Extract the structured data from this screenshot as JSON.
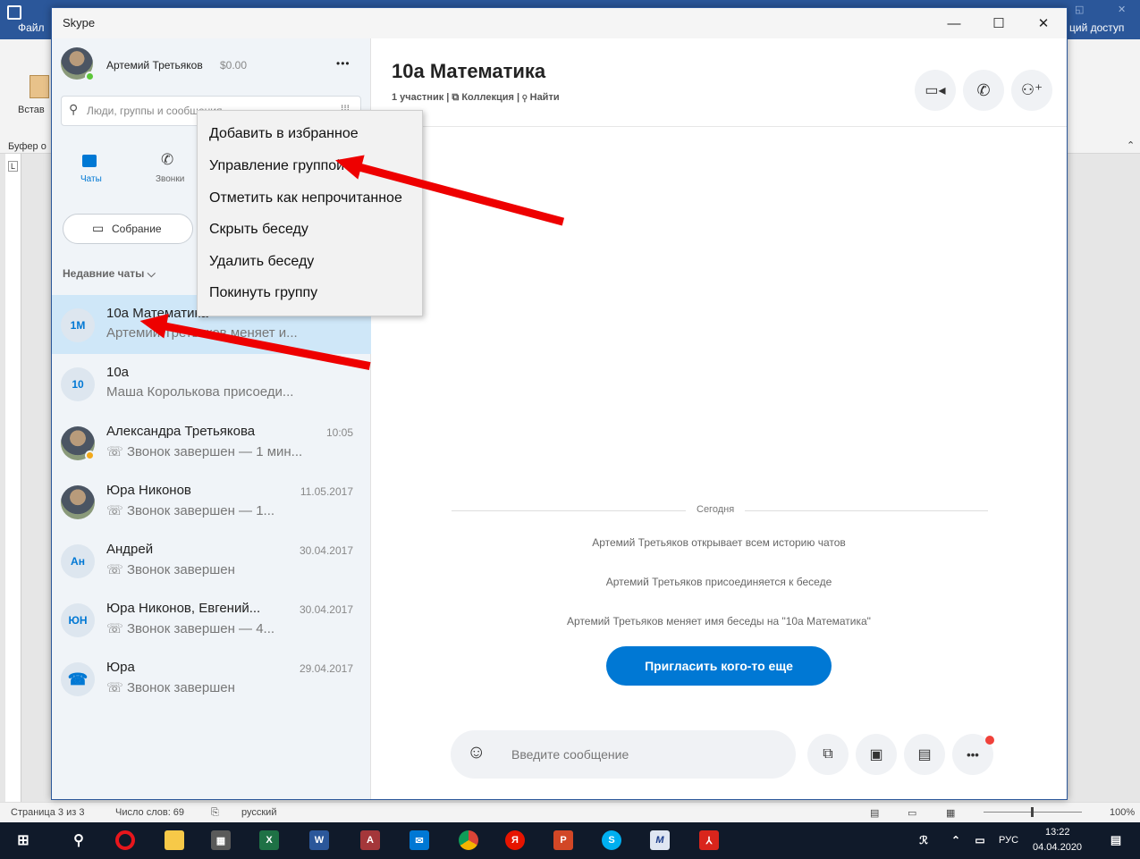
{
  "word": {
    "menu_file": "Файл",
    "share": "ций доступ",
    "paste": "Встав",
    "clipboard": "Буфер о",
    "ruler_tab": "L",
    "status": {
      "page": "Страница 3 из 3",
      "words": "Число слов: 69",
      "lang": "русский",
      "zoom": "100%"
    }
  },
  "skype": {
    "window_title": "Skype",
    "profile": {
      "name": "Артемий Третьяков",
      "balance": "$0.00",
      "more": "•••"
    },
    "search_placeholder": "Люди, группы и сообщения",
    "nav": {
      "chats": "Чаты",
      "calls": "Звонки"
    },
    "meeting_button": "Собрание",
    "recent_header": "Недавние чаты",
    "chats": [
      {
        "initials": "1M",
        "name": "10а Математика",
        "preview": "Артемий Третьяков меняет и...",
        "time": ""
      },
      {
        "initials": "10",
        "name": "10а",
        "preview": "Маша Королькова присоеди...",
        "time": ""
      },
      {
        "initials": "",
        "name": "Александра Третьякова",
        "preview": "Звонок завершен — 1 мин...",
        "time": "10:05"
      },
      {
        "initials": "",
        "name": "Юра Никонов",
        "preview": "Звонок завершен — 1...",
        "time": "11.05.2017"
      },
      {
        "initials": "Ан",
        "name": "Андрей",
        "preview": "Звонок завершен",
        "time": "30.04.2017"
      },
      {
        "initials": "ЮН",
        "name": "Юра Никонов, Евгений...",
        "preview": "Звонок завершен — 4...",
        "time": "30.04.2017"
      },
      {
        "initials": "",
        "name": "Юра",
        "preview": "Звонок завершен",
        "time": "29.04.2017"
      }
    ],
    "conversation": {
      "title": "10а Математика",
      "participants": "1 участник",
      "collection": "Коллекция",
      "find": "Найти",
      "date_divider": "Сегодня",
      "messages": [
        "Артемий Третьяков открывает всем историю чатов",
        "Артемий Третьяков присоединяется к беседе",
        "Артемий Третьяков меняет имя беседы на \"10а Математика\""
      ],
      "invite_button": "Пригласить кого-то еще",
      "input_placeholder": "Введите сообщение"
    },
    "context_menu": [
      "Добавить в избранное",
      "Управление группой",
      "Отметить как непрочитанное",
      "Скрыть беседу",
      "Удалить беседу",
      "Покинуть группу"
    ]
  },
  "taskbar": {
    "lang": "РУС",
    "time": "13:22",
    "date": "04.04.2020"
  }
}
